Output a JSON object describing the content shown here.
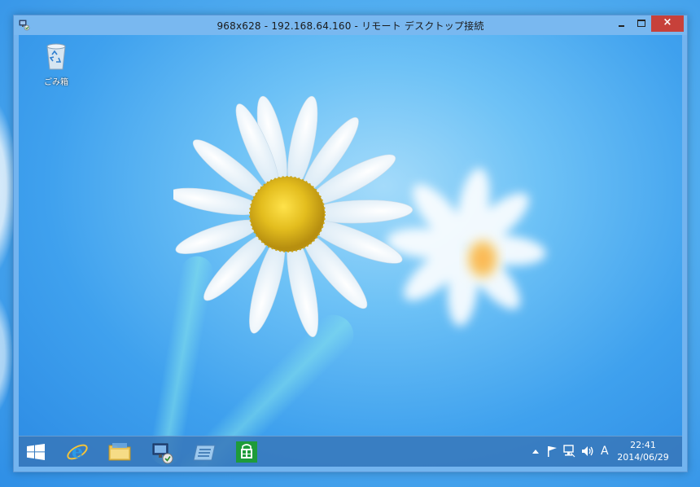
{
  "window": {
    "title": "968x628 - 192.168.64.160 - リモート デスクトップ接続",
    "close_glyph": "×"
  },
  "desktop": {
    "icons": [
      {
        "label": "ごみ箱",
        "icon": "recycle-bin-icon"
      }
    ],
    "wallpaper": "daisy-flowers-on-blue"
  },
  "taskbar": {
    "pinned": [
      {
        "name": "start-button",
        "icon": "windows-logo-icon"
      },
      {
        "name": "internet-explorer",
        "icon": "internet-explorer-icon"
      },
      {
        "name": "file-explorer",
        "icon": "folder-icon"
      },
      {
        "name": "remote-desktop",
        "icon": "remote-desktop-icon"
      },
      {
        "name": "server-manager",
        "icon": "server-manager-icon"
      },
      {
        "name": "store",
        "icon": "store-icon"
      }
    ],
    "tray": {
      "ime": "A",
      "time": "22:41",
      "date": "2014/06/29"
    }
  },
  "colors": {
    "close_button": "#c7413a",
    "titlebar": "#79b8f0",
    "taskbar": "#3876b8"
  }
}
